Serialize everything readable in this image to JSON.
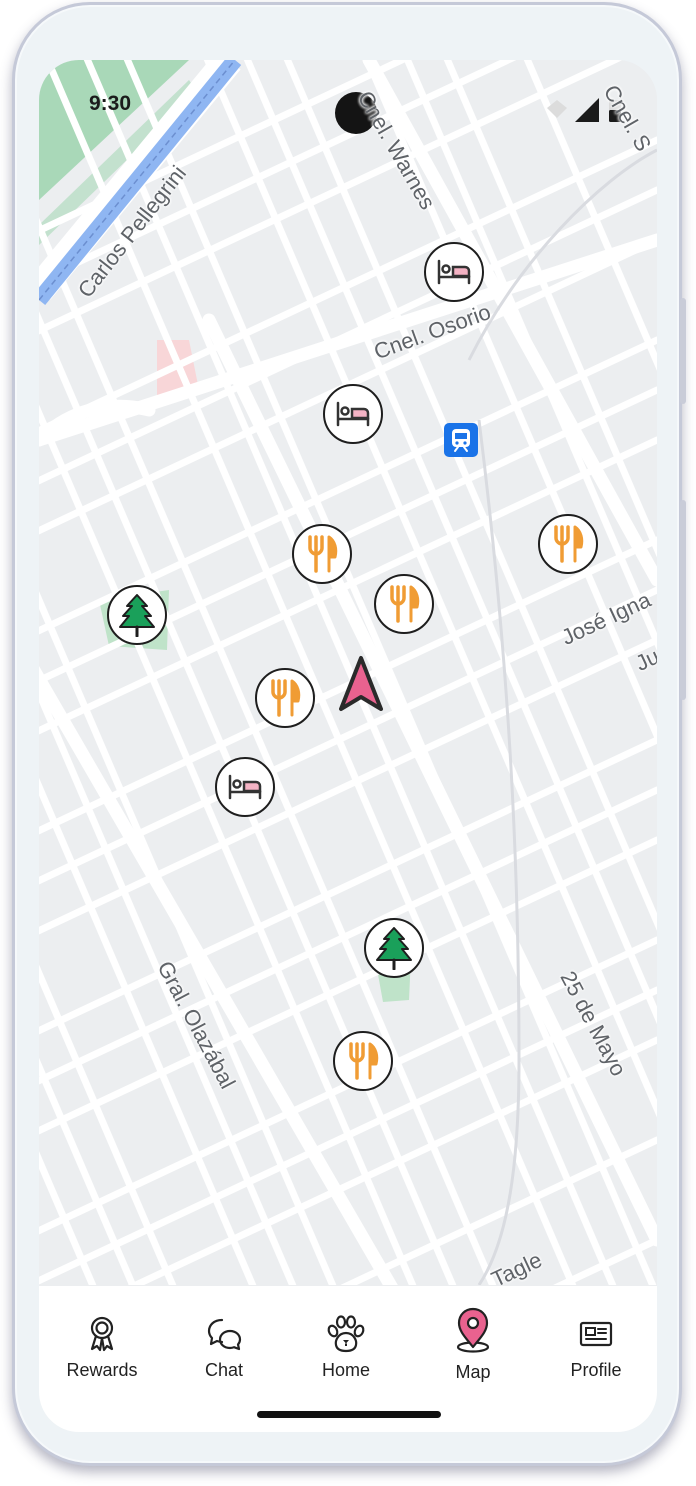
{
  "status_bar": {
    "time": "9:30"
  },
  "map": {
    "streets": {
      "carlos_pellegrini": "Carlos Pellegrini",
      "cnel_warnes": "Cnel. Warnes",
      "cnel_osorio": "Cnel. Osorio",
      "cnel_s": "Cnel. S",
      "jose_igna": "José Igna",
      "ju": "Ju",
      "gral_olazabal": "Gral. Olazábal",
      "veinticinco_de_mayo": "25 de Mayo",
      "tagle": "Tagle"
    },
    "markers": [
      {
        "type": "hotel-icon"
      },
      {
        "type": "hotel-icon"
      },
      {
        "type": "restaurant-icon"
      },
      {
        "type": "restaurant-icon"
      },
      {
        "type": "restaurant-icon"
      },
      {
        "type": "park-icon"
      },
      {
        "type": "restaurant-icon"
      },
      {
        "type": "hotel-icon"
      },
      {
        "type": "park-icon"
      },
      {
        "type": "restaurant-icon"
      }
    ],
    "colors": {
      "hotel_accent": "#f4b3c4",
      "restaurant": "#f09c34",
      "park": "#1aa05a",
      "map_background": "#eceef0",
      "road": "#ffffff",
      "highway": "#8fb6f2",
      "transit": "#1a73e8",
      "location_arrow": "#e9628f"
    }
  },
  "bottom_nav": {
    "items": [
      {
        "label": "Rewards",
        "icon": "award-icon"
      },
      {
        "label": "Chat",
        "icon": "chat-icon"
      },
      {
        "label": "Home",
        "icon": "paw-icon"
      },
      {
        "label": "Map",
        "icon": "map-pin-icon",
        "active": true
      },
      {
        "label": "Profile",
        "icon": "id-card-icon"
      }
    ],
    "active_color": "#e9628f"
  }
}
